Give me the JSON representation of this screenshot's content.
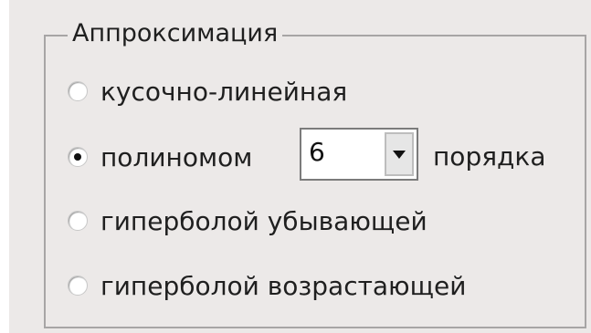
{
  "group": {
    "title": "Аппроксимация"
  },
  "options": {
    "piecewise_linear": {
      "label": "кусочно-линейная",
      "checked": false
    },
    "polynomial": {
      "label": "полиномом",
      "checked": true,
      "order_value": "6",
      "suffix": "порядка"
    },
    "decreasing_hyperbola": {
      "label": "гиперболой убывающей",
      "checked": false
    },
    "increasing_hyperbola": {
      "label": "гиперболой возрастающей",
      "checked": false
    }
  },
  "icons": {
    "dropdown_arrow": "chevron-down-icon"
  }
}
